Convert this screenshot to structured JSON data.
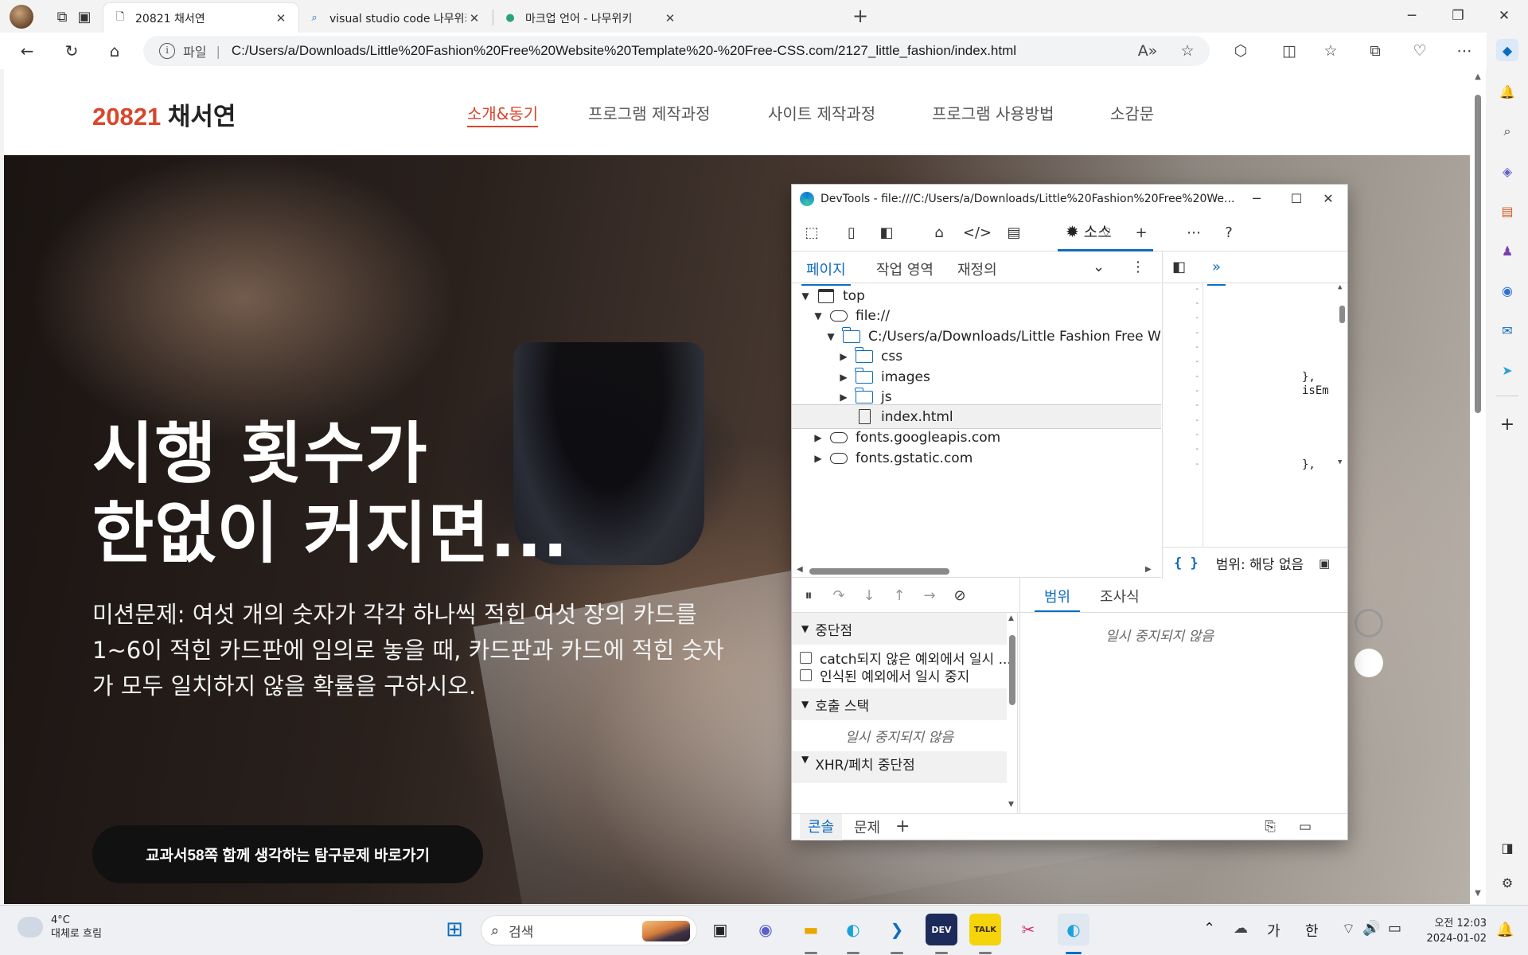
{
  "browser": {
    "tabs": [
      {
        "title": "20821 채서연",
        "icon": "page-icon"
      },
      {
        "title": "visual studio code 나무위키 - 검색",
        "icon": "search-icon"
      },
      {
        "title": "마크업 언어 - 나무위키",
        "icon": "namuwiki-icon"
      }
    ],
    "url_scheme": "파일",
    "url": "C:/Users/a/Downloads/Little%20Fashion%20Free%20Website%20Template%20-%20Free-CSS.com/2127_little_fashion/index.html"
  },
  "site": {
    "brand_number": "20821",
    "brand_name": "채서연",
    "nav": [
      "소개&동기",
      "프로그램 제작과정",
      "사이트 제작과정",
      "프로그램 사용방법",
      "소감문"
    ],
    "hero_title_line1": "시행 횟수가",
    "hero_title_line2": "한없이 커지면...",
    "hero_desc": "미션문제: 여섯 개의 숫자가 각각 하나씩 적힌 여섯 장의 카드를 1~6이 적힌 카드판에 임의로 놓을 때, 카드판과 카드에 적힌 숫자가 모두 일치하지 않을 확률을 구하시오.",
    "hero_button": "교과서58쪽 함께 생각하는 탐구문제 바로가기"
  },
  "devtools": {
    "title": "DevTools - file:///C:/Users/a/Downloads/Little%20Fashion%20Free%20We...",
    "sources_tab": "소스",
    "subtabs": [
      "페이지",
      "작업 영역",
      "재정의"
    ],
    "tree": {
      "top": "top",
      "file": "file://",
      "folder": "C:/Users/a/Downloads/Little Fashion Free W",
      "css": "css",
      "images": "images",
      "js": "js",
      "index": "index.html",
      "fonts1": "fonts.googleapis.com",
      "fonts2": "fonts.gstatic.com"
    },
    "code_line1": "},",
    "code_line2": "isEm",
    "code_line3": "},",
    "range_label": "범위: 해당 없음",
    "breakpoints": "중단점",
    "cb1": "catch되지 않은 예외에서 일시 ...",
    "cb2": "인식된 예외에서 일시 중지",
    "call_stack": "호출 스택",
    "not_paused": "일시 중지되지 않음",
    "xhr_partial": "XHR/페치 중단점",
    "scope_tab": "범위",
    "watch_tab": "조사식",
    "scope_not_paused": "일시 중지되지 않음",
    "drawer_tabs": [
      "콘솔",
      "문제"
    ]
  },
  "taskbar": {
    "temp": "4°C",
    "weather": "대체로 흐림",
    "search_placeholder": "검색",
    "ime1": "가",
    "ime2": "한",
    "time": "오전 12:03",
    "date": "2024-01-02"
  },
  "colors": {
    "accent": "#d9462b",
    "devtools_blue": "#0f6cbd"
  }
}
